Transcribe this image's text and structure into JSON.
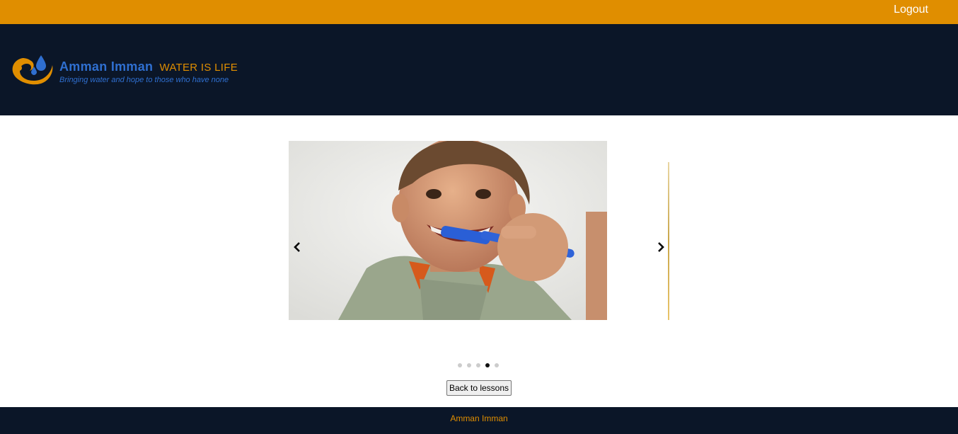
{
  "topbar": {
    "logout_label": "Logout",
    "color": "#e08e00"
  },
  "header": {
    "brand_name": "Amman Imman",
    "brand_tagline": "WATER IS LIFE",
    "slogan": "Bringing water and hope to those who have none",
    "background": "#0b1628"
  },
  "carousel": {
    "current_slide_description": "child-brushing-teeth-photo",
    "prev_icon": "chevron-left-icon",
    "next_icon": "chevron-right-icon",
    "slide_count": 5,
    "active_index": 3
  },
  "main": {
    "back_label": "Back to lessons"
  },
  "footer": {
    "text": "Amman Imman"
  }
}
